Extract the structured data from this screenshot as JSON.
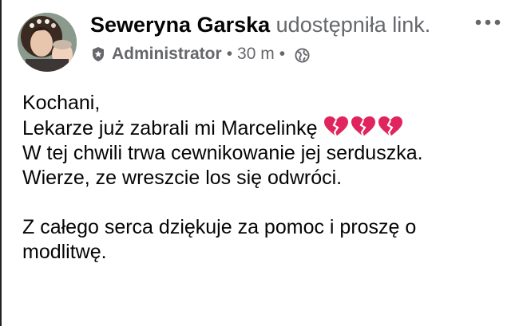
{
  "post": {
    "author": "Seweryna Garska",
    "action": " udostępniła link.",
    "role": "Administrator",
    "separator": "•",
    "time": "30 m",
    "lines": [
      "Kochani,",
      "Lekarze już zabrali mi Marcelinkę",
      "W tej chwili trwa cewnikowanie jej serduszka.",
      "Wierze, ze wreszcie los się odwróci.",
      "",
      "Z całego serca dziękuje za pomoc i proszę o",
      "modlitwę."
    ],
    "emoji": [
      "broken-heart-icon",
      "broken-heart-icon",
      "broken-heart-icon"
    ]
  },
  "colors": {
    "text": "#050505",
    "secondary": "#65676b",
    "heart": "#e0245e"
  }
}
